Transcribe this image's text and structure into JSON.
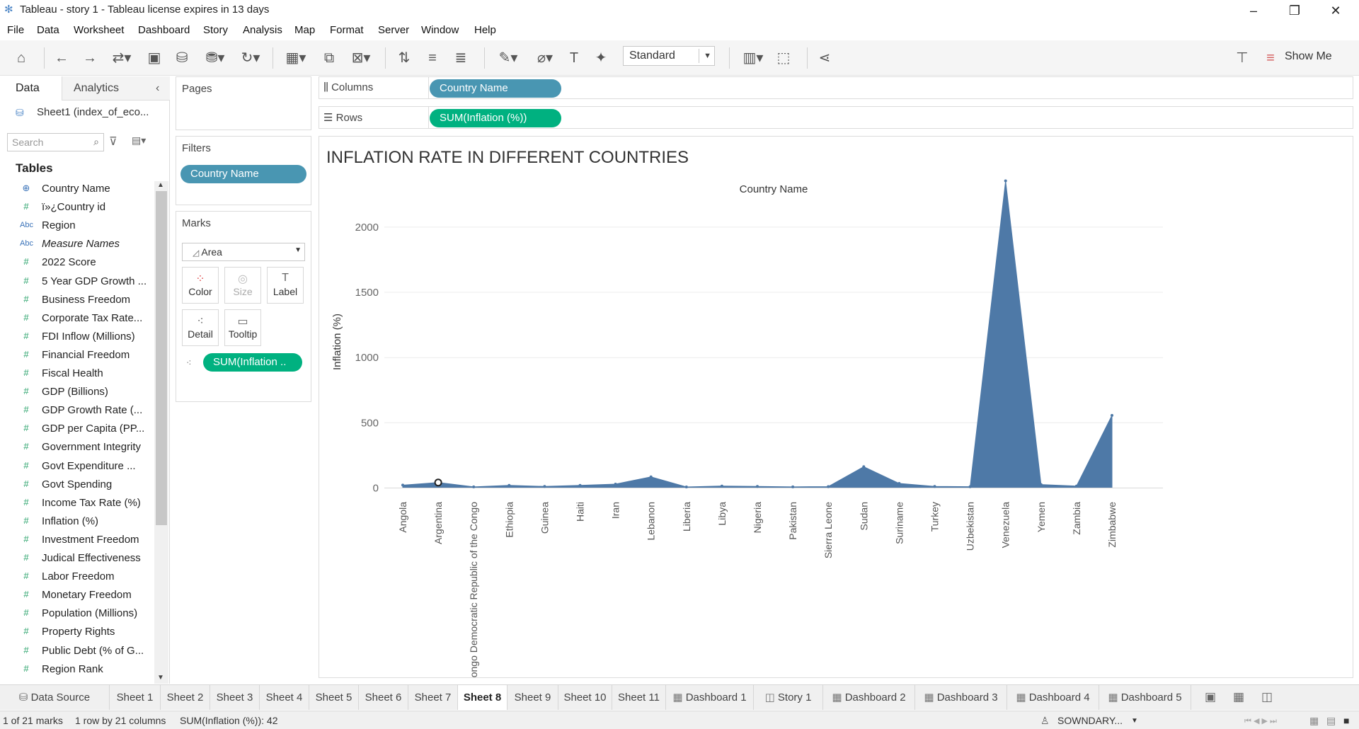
{
  "window": {
    "title": "Tableau - story 1 - Tableau license expires in 13 days"
  },
  "menu": [
    "File",
    "Data",
    "Worksheet",
    "Dashboard",
    "Story",
    "Analysis",
    "Map",
    "Format",
    "Server",
    "Window",
    "Help"
  ],
  "toolbar": {
    "fit_select": "Standard",
    "show_me": "Show Me"
  },
  "data_pane": {
    "tab_data": "Data",
    "tab_analytics": "Analytics",
    "data_source": "Sheet1 (index_of_eco...",
    "search_placeholder": "Search",
    "tables_heading": "Tables",
    "fields": [
      {
        "icon": "globe-icon",
        "label": "Country Name",
        "italic": false
      },
      {
        "icon": "number-icon",
        "label": "ï»¿Country id",
        "italic": false
      },
      {
        "icon": "abc-icon",
        "label": "Region",
        "italic": false
      },
      {
        "icon": "abc-icon",
        "label": "Measure Names",
        "italic": true
      },
      {
        "icon": "number-icon",
        "label": "2022 Score",
        "italic": false
      },
      {
        "icon": "number-icon",
        "label": "5 Year GDP Growth ...",
        "italic": false
      },
      {
        "icon": "number-icon",
        "label": "Business Freedom",
        "italic": false
      },
      {
        "icon": "number-icon",
        "label": "Corporate Tax Rate...",
        "italic": false
      },
      {
        "icon": "number-icon",
        "label": "FDI Inflow (Millions)",
        "italic": false
      },
      {
        "icon": "number-icon",
        "label": "Financial Freedom",
        "italic": false
      },
      {
        "icon": "number-icon",
        "label": "Fiscal Health",
        "italic": false
      },
      {
        "icon": "number-icon",
        "label": "GDP (Billions)",
        "italic": false
      },
      {
        "icon": "number-icon",
        "label": "GDP Growth Rate (...",
        "italic": false
      },
      {
        "icon": "number-icon",
        "label": "GDP per Capita (PP...",
        "italic": false
      },
      {
        "icon": "number-icon",
        "label": "Government Integrity",
        "italic": false
      },
      {
        "icon": "number-icon",
        "label": "Govt Expenditure ...",
        "italic": false
      },
      {
        "icon": "number-icon",
        "label": "Govt Spending",
        "italic": false
      },
      {
        "icon": "number-icon",
        "label": "Income Tax Rate (%)",
        "italic": false
      },
      {
        "icon": "number-icon",
        "label": "Inflation (%)",
        "italic": false
      },
      {
        "icon": "number-icon",
        "label": "Investment Freedom",
        "italic": false
      },
      {
        "icon": "number-icon",
        "label": "Judical Effectiveness",
        "italic": false
      },
      {
        "icon": "number-icon",
        "label": "Labor Freedom",
        "italic": false
      },
      {
        "icon": "number-icon",
        "label": "Monetary Freedom",
        "italic": false
      },
      {
        "icon": "number-icon",
        "label": "Population (Millions)",
        "italic": false
      },
      {
        "icon": "number-icon",
        "label": "Property Rights",
        "italic": false
      },
      {
        "icon": "number-icon",
        "label": "Public Debt (% of G...",
        "italic": false
      },
      {
        "icon": "number-icon",
        "label": "Region Rank",
        "italic": false
      }
    ]
  },
  "pages_card": {
    "title": "Pages"
  },
  "filters_card": {
    "title": "Filters",
    "pill": "Country Name"
  },
  "marks_card": {
    "title": "Marks",
    "type": "Area",
    "buttons": [
      "Color",
      "Size",
      "Label",
      "Detail",
      "Tooltip"
    ],
    "pill": "SUM(Inflation .."
  },
  "shelves": {
    "columns_label": "Columns",
    "columns_pill": "Country Name",
    "rows_label": "Rows",
    "rows_pill": "SUM(Inflation (%))"
  },
  "viz_title": "INFLATION RATE IN DIFFERENT COUNTRIES",
  "chart_data": {
    "type": "area",
    "title": "INFLATION RATE IN DIFFERENT COUNTRIES",
    "header_label": "Country Name",
    "xlabel": "",
    "ylabel": "Inflation (%)",
    "ylim": [
      -30,
      2450
    ],
    "yticks": [
      0,
      500,
      1000,
      1500,
      2000
    ],
    "grid": true,
    "color": "#4e79a7",
    "categories": [
      "Angola",
      "Argentina",
      "Congo Democratic Republic of the Congo",
      "Ethiopia",
      "Guinea",
      "Haiti",
      "Iran",
      "Lebanon",
      "Liberia",
      "Libya",
      "Nigeria",
      "Pakistan",
      "Sierra Leone",
      "Sudan",
      "Suriname",
      "Turkey",
      "Uzbekistan",
      "Venezuela",
      "Yemen",
      "Zambia",
      "Zimbabwe"
    ],
    "values": [
      22,
      42,
      9,
      20,
      12,
      20,
      30,
      85,
      8,
      15,
      12,
      9,
      11,
      163,
      35,
      12,
      10,
      2355,
      26,
      15,
      557
    ],
    "selected_index": 1
  },
  "tabs": {
    "data_source": "Data Source",
    "sheets": [
      "Sheet 1",
      "Sheet 2",
      "Sheet 3",
      "Sheet 4",
      "Sheet 5",
      "Sheet 6",
      "Sheet 7",
      "Sheet 8",
      "Sheet 9",
      "Sheet 10",
      "Sheet 11",
      "Dashboard 1",
      "Story 1",
      "Dashboard 2",
      "Dashboard 3",
      "Dashboard 4",
      "Dashboard 5"
    ],
    "active": "Sheet 8"
  },
  "status": {
    "marks": "1 of 21 marks",
    "dims": "1 row by 21 columns",
    "sum": "SUM(Inflation (%)): 42",
    "user": "SOWNDARY..."
  }
}
